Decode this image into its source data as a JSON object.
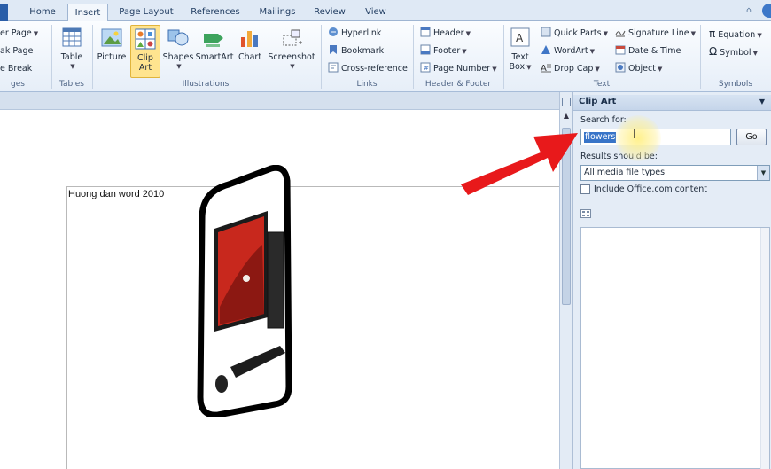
{
  "tabs": [
    "Home",
    "Insert",
    "Page Layout",
    "References",
    "Mailings",
    "Review",
    "View"
  ],
  "active_tab": "Insert",
  "ribbon": {
    "pages": {
      "items": [
        "er Page",
        "ak Page",
        "e Break"
      ],
      "group": "ges"
    },
    "tables": {
      "table_label": "Table",
      "group": "Tables"
    },
    "illustrations": {
      "picture": "Picture",
      "clipart_line1": "Clip",
      "clipart_line2": "Art",
      "shapes": "Shapes",
      "smartart": "SmartArt",
      "chart": "Chart",
      "screenshot": "Screenshot",
      "group": "Illustrations"
    },
    "links": {
      "hyperlink": "Hyperlink",
      "bookmark": "Bookmark",
      "cross_reference": "Cross-reference",
      "group": "Links"
    },
    "header_footer": {
      "header": "Header",
      "footer": "Footer",
      "page_number": "Page Number",
      "group": "Header & Footer"
    },
    "text": {
      "textbox_line1": "Text",
      "textbox_line2": "Box",
      "quick_parts": "Quick Parts",
      "wordart": "WordArt",
      "drop_cap": "Drop Cap",
      "signature_line": "Signature Line",
      "date_time": "Date & Time",
      "object": "Object",
      "group": "Text"
    },
    "symbols": {
      "equation": "Equation",
      "symbol": "Symbol",
      "group": "Symbols"
    }
  },
  "document": {
    "text": "Huong dan word 2010"
  },
  "pane": {
    "title": "Clip Art",
    "search_label": "Search for:",
    "search_value": "flowers",
    "go": "Go",
    "results_label": "Results should be:",
    "results_value": "All media file types",
    "office_label": "Include Office.com content"
  },
  "colors": {
    "accent": "#2a5ea8",
    "arrow": "#e8191b",
    "selected_button": "#ffe48f"
  }
}
